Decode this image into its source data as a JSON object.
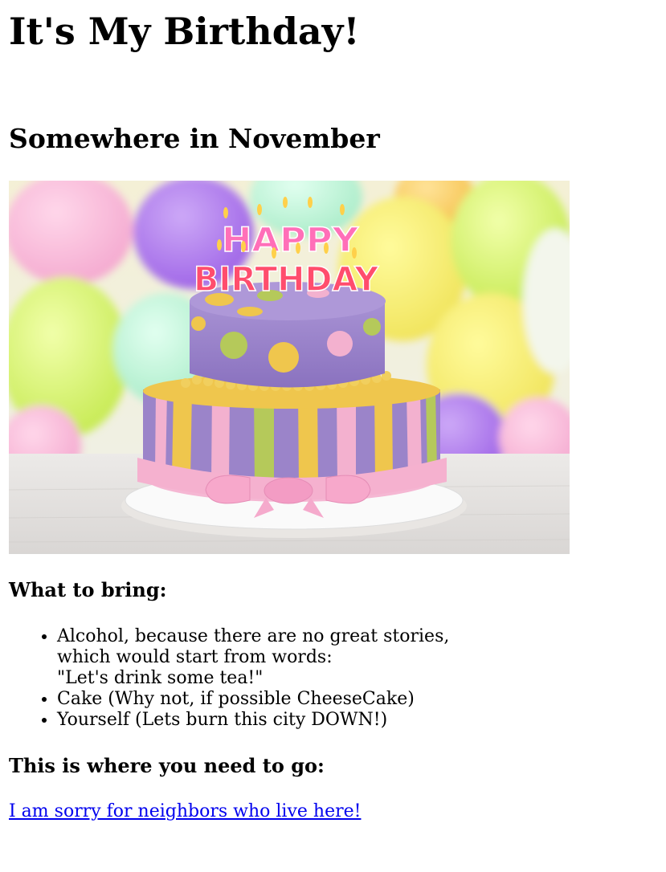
{
  "header": {
    "title": "It's My Birthday!",
    "subtitle": "Somewhere in November"
  },
  "photo": {
    "cake_topper_line1": "HAPPY",
    "cake_topper_line2": "BIRTHDAY",
    "colors": {
      "cake_purple": "#9b84c9",
      "cake_pink": "#f3b1cf",
      "cake_yellow": "#efc64d",
      "cake_green": "#b5c95a"
    }
  },
  "bring": {
    "heading": "What to bring:",
    "items": [
      {
        "lines": [
          "Alcohol, because there are no great stories,",
          "which would start from words:",
          "\"Let's drink some tea!\""
        ]
      },
      {
        "text": "Cake (Why not, if possible CheeseCake)"
      },
      {
        "text": "Yourself (Lets burn this city DOWN!)"
      }
    ]
  },
  "directions": {
    "heading": "This is where you need to go:",
    "link_text": "I am sorry for neighbors who live here!"
  }
}
